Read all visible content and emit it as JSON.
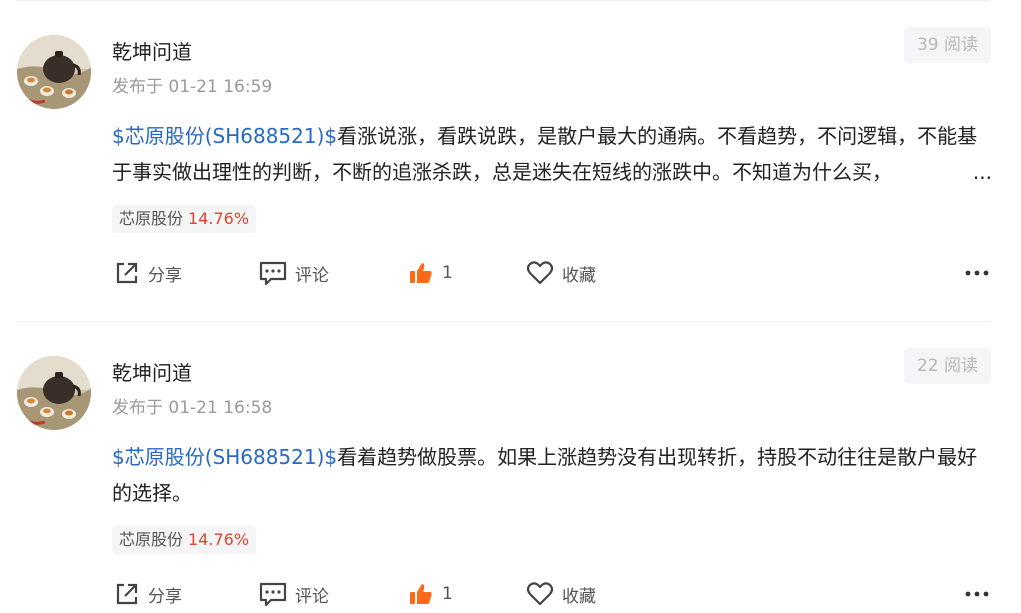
{
  "posts": [
    {
      "author": "乾坤问道",
      "time": "发布于 01-21 16:59",
      "read_count": "39 阅读",
      "stock_link": "$芯原股份(SH688521)$",
      "text": "看涨说涨，看跌说跌，是散户最大的通病。不看趋势，不问逻辑，不能基于事实做出理性的判断，不断的追涨杀跌，总是迷失在短线的涨跌中。不知道为什么买，",
      "truncated": "...",
      "tag_name": "芯原股份",
      "tag_change": "14.76%",
      "share_label": "分享",
      "comment_label": "评论",
      "like_count": "1",
      "favorite_label": "收藏",
      "more_icon": "more-dots-icon"
    },
    {
      "author": "乾坤问道",
      "time": "发布于 01-21 16:58",
      "read_count": "22 阅读",
      "stock_link": "$芯原股份(SH688521)$",
      "text": "看着趋势做股票。如果上涨趋势没有出现转折，持股不动往往是散户最好的选择。",
      "truncated": "",
      "tag_name": "芯原股份",
      "tag_change": "14.76%",
      "share_label": "分享",
      "comment_label": "评论",
      "like_count": "1",
      "favorite_label": "收藏",
      "more_icon": "more-dots-icon"
    }
  ],
  "colors": {
    "link": "#2769c5",
    "up": "#e0442c",
    "like": "#ff6a1a"
  }
}
